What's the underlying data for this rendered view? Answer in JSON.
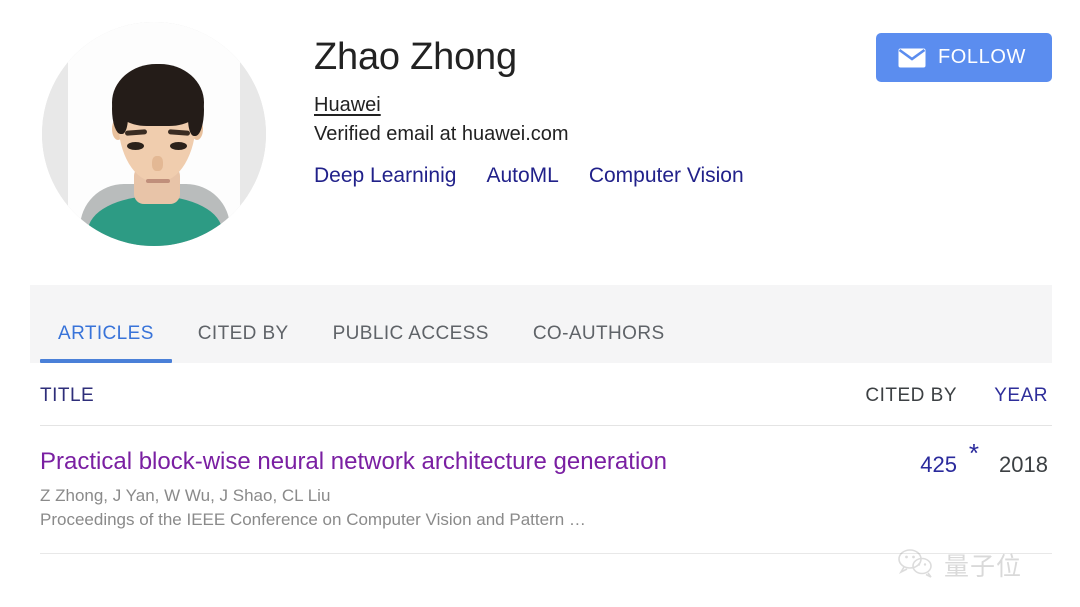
{
  "profile": {
    "name": "Zhao Zhong",
    "affiliation": "Huawei",
    "verified_email": "Verified email at huawei.com",
    "interests": [
      {
        "label": "Deep Learninig"
      },
      {
        "label": "AutoML"
      },
      {
        "label": "Computer Vision"
      }
    ],
    "avatar_alt": "profile-photo",
    "follow_label": "FOLLOW",
    "follow_icon": "envelope-icon"
  },
  "tabs": [
    {
      "label": "ARTICLES",
      "active": true
    },
    {
      "label": "CITED BY",
      "active": false
    },
    {
      "label": "PUBLIC ACCESS",
      "active": false
    },
    {
      "label": "CO-AUTHORS",
      "active": false
    }
  ],
  "table": {
    "headers": {
      "title": "TITLE",
      "cited_by": "CITED BY",
      "year": "YEAR"
    },
    "rows": [
      {
        "title": "Practical block-wise neural network architecture generation",
        "authors": "Z Zhong, J Yan, W Wu, J Shao, CL Liu",
        "venue": "Proceedings of the IEEE Conference on Computer Vision and Pattern …",
        "cited_by": "425",
        "cited_star": "*",
        "year": "2018"
      }
    ]
  },
  "watermark": {
    "text": "量子位",
    "icon": "wechat-icon"
  },
  "colors": {
    "follow_blue": "#5b8def",
    "tab_active_blue": "#3873d9",
    "tab_underline": "#4a80d8",
    "link_blue": "#21218a",
    "visited_purple": "#7a1fa2",
    "muted_gray": "#8a8a8a",
    "tab_strip_bg": "#f5f5f6"
  }
}
